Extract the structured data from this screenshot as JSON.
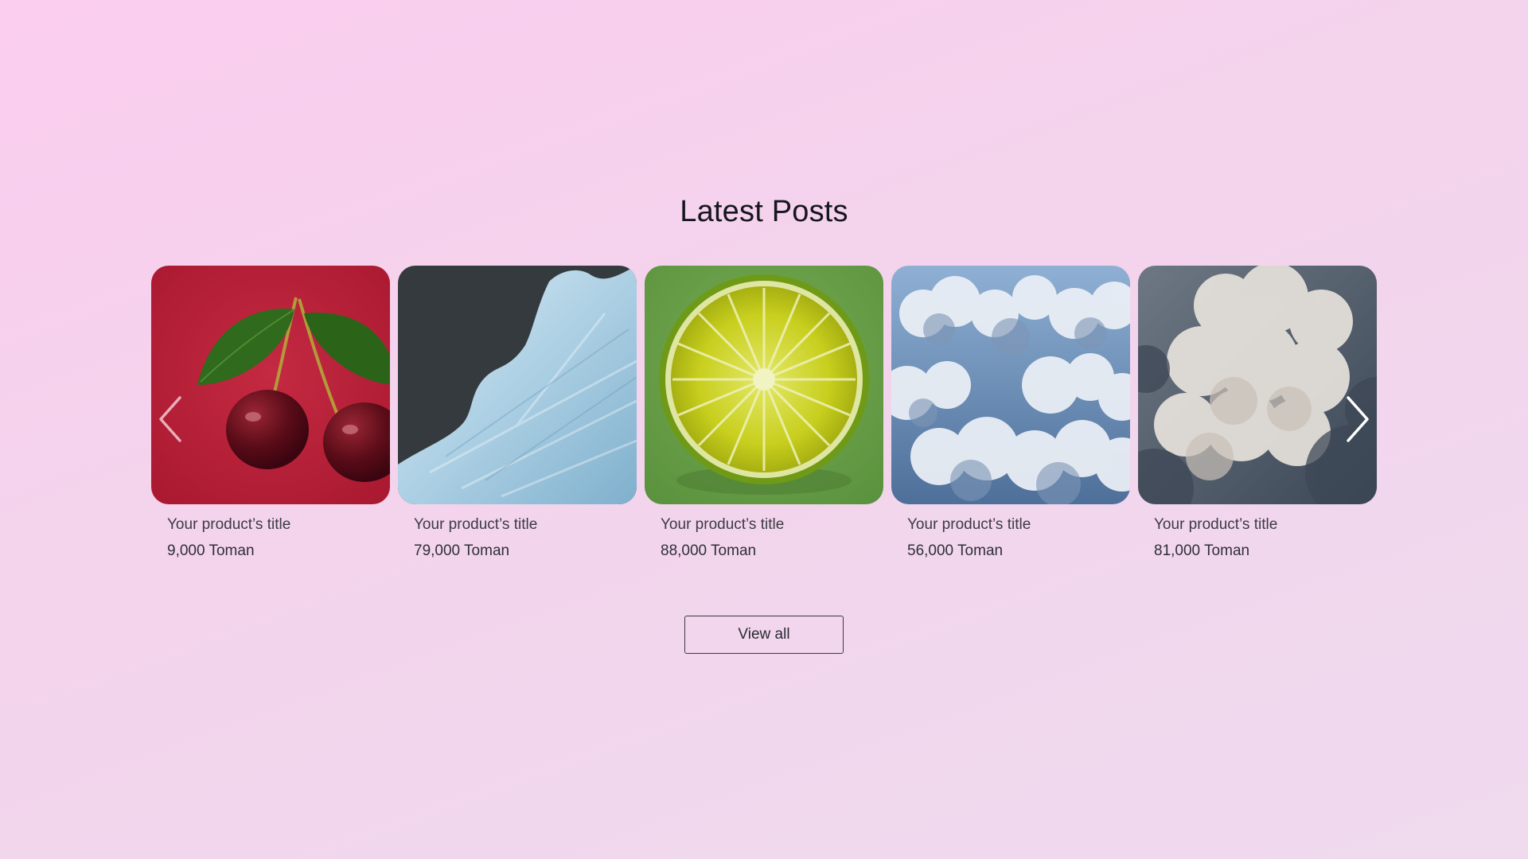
{
  "section": {
    "heading": "Latest Posts",
    "view_all_label": "View all"
  },
  "carousel": {
    "prev_icon": "chevron-left-icon",
    "next_icon": "chevron-right-icon",
    "items": [
      {
        "title": "Your product’s title",
        "price": "9,000 Toman",
        "image": "cherries on red background"
      },
      {
        "title": "Your product’s title",
        "price": "79,000 Toman",
        "image": "icy blue shape on dark background"
      },
      {
        "title": "Your product’s title",
        "price": "88,000 Toman",
        "image": "lime slice on green background"
      },
      {
        "title": "Your product’s title",
        "price": "56,000 Toman",
        "image": "blue sky with clouds"
      },
      {
        "title": "Your product’s title",
        "price": "81,000 Toman",
        "image": "grey storm clouds"
      }
    ]
  },
  "colors": {
    "background_top": "#fbcdef",
    "background_bottom": "#efdaee",
    "text": "#16161e"
  }
}
